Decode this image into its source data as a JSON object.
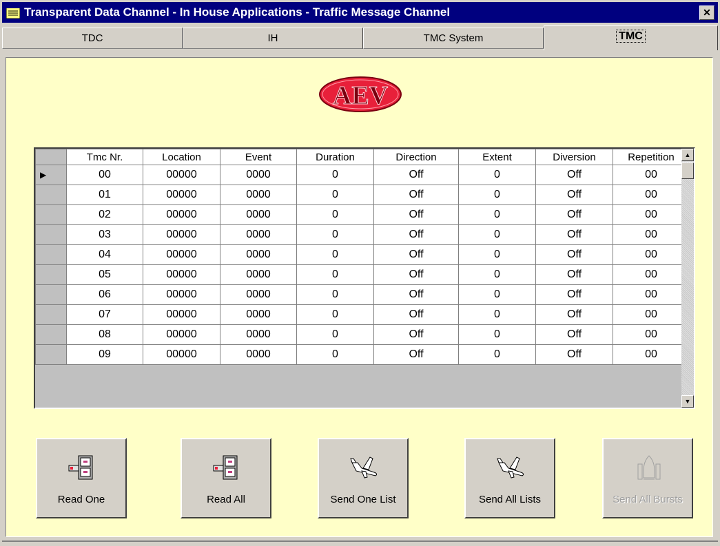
{
  "window": {
    "title": "Transparent Data Channel - In House Applications - Traffic Message Channel",
    "close_glyph": "✕"
  },
  "tabs": [
    {
      "label": "TDC"
    },
    {
      "label": "IH"
    },
    {
      "label": "TMC System"
    },
    {
      "label": "TMC"
    }
  ],
  "active_tab": "TMC",
  "logo": {
    "text": "AEV"
  },
  "grid": {
    "columns": [
      "Tmc Nr.",
      "Location",
      "Event",
      "Duration",
      "Direction",
      "Extent",
      "Diversion",
      "Repetition"
    ],
    "rows": [
      [
        "00",
        "00000",
        "0000",
        "0",
        "Off",
        "0",
        "Off",
        "00"
      ],
      [
        "01",
        "00000",
        "0000",
        "0",
        "Off",
        "0",
        "Off",
        "00"
      ],
      [
        "02",
        "00000",
        "0000",
        "0",
        "Off",
        "0",
        "Off",
        "00"
      ],
      [
        "03",
        "00000",
        "0000",
        "0",
        "Off",
        "0",
        "Off",
        "00"
      ],
      [
        "04",
        "00000",
        "0000",
        "0",
        "Off",
        "0",
        "Off",
        "00"
      ],
      [
        "05",
        "00000",
        "0000",
        "0",
        "Off",
        "0",
        "Off",
        "00"
      ],
      [
        "06",
        "00000",
        "0000",
        "0",
        "Off",
        "0",
        "Off",
        "00"
      ],
      [
        "07",
        "00000",
        "0000",
        "0",
        "Off",
        "0",
        "Off",
        "00"
      ],
      [
        "08",
        "00000",
        "0000",
        "0",
        "Off",
        "0",
        "Off",
        "00"
      ],
      [
        "09",
        "00000",
        "0000",
        "0",
        "Off",
        "0",
        "Off",
        "00"
      ]
    ],
    "current_row_marker": "▶"
  },
  "buttons": {
    "read_one": "Read One",
    "read_all": "Read All",
    "send_one_list": "Send One List",
    "send_all_lists": "Send All Lists",
    "send_all_bursts": "Send All Bursts"
  },
  "icons": {
    "read_one": "file-cabinet-icon",
    "read_all": "file-cabinet-icon",
    "send_one_list": "airplane-icon",
    "send_all_lists": "airplane-icon",
    "send_all_bursts": "space-shuttle-icon"
  },
  "colors": {
    "title_bar": "#00007f",
    "panel_bg": "#ffffc8",
    "logo_red": "#e8203a"
  }
}
